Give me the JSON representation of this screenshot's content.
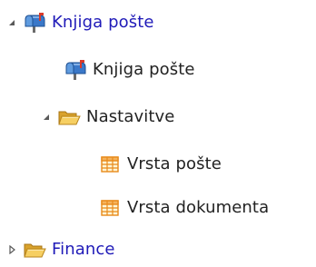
{
  "tree": {
    "items": [
      {
        "label": "Knjiga pošte",
        "icon": "mailbox-icon",
        "expanded": true,
        "toggle": "expanded"
      },
      {
        "label": "Knjiga pošte",
        "icon": "mailbox-icon"
      },
      {
        "label": "Nastavitve",
        "icon": "folder-open-icon",
        "expanded": true,
        "toggle": "expanded"
      },
      {
        "label": "Vrsta pošte",
        "icon": "table-icon"
      },
      {
        "label": "Vrsta dokumenta",
        "icon": "table-icon"
      },
      {
        "label": "Finance",
        "icon": "folder-open-icon",
        "expanded": false,
        "toggle": "collapsed"
      }
    ]
  },
  "colors": {
    "link": "#1f1ab8",
    "text": "#222222",
    "folder": "#f2c24a",
    "table_grid": "#e88a1a",
    "mailbox_blue": "#3a78c9",
    "mailbox_red": "#d93a2a"
  }
}
